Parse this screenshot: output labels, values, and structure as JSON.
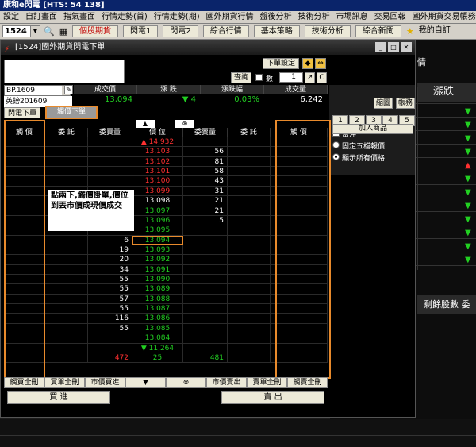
{
  "app": {
    "title": "康和e閃電 [HTS: 54 138]"
  },
  "menu": [
    "設定",
    "自訂畫面",
    "指氣畫面",
    "行情走勢(首)",
    "行情走勢(期)",
    "國外期貨行情",
    "盤後分析",
    "技術分析",
    "市場訊息",
    "交易回報",
    "國外期貨交易帳務",
    "智慧下單"
  ],
  "toolbar": {
    "symbol": "1524",
    "buttons": [
      "個股期貨",
      "閃電1",
      "閃電2",
      "綜合行情",
      "基本策略",
      "技術分析",
      "綜合新聞"
    ],
    "favorite": "我的自訂"
  },
  "window": {
    "title": "[1524]國外期貨閃電下單",
    "order_setting": "下單設定",
    "query": "查詢",
    "qty_label": "數",
    "qty_value": "1",
    "contract_code": "BP.1609",
    "contract_name": "英鎊201609",
    "quote_headers": [
      "成交價",
      "漲 跌",
      "漲跌幅",
      "成交量"
    ],
    "quote_values": {
      "price": "13,094",
      "change": "▼ 4",
      "pct": "0.03%",
      "volume": "6,242"
    },
    "tabs": [
      "閃電下單",
      "觸價下單"
    ],
    "right": {
      "btn_zoom": "縮圖",
      "btn_account": "帳務",
      "num_buttons": [
        "1",
        "2",
        "3",
        "4",
        "5"
      ],
      "opt_offset": "當沖",
      "opt_fixed": "固定五檔報價",
      "opt_all": "顯示所有價格",
      "add_item": "加入商品"
    },
    "ladder_head": {
      "up": "▲",
      "down": "⊗"
    },
    "columns": [
      "觸 價",
      "委 託",
      "委買量",
      "價 位",
      "委賣量",
      "委 託",
      "觸 價"
    ],
    "rows": [
      {
        "bid": "",
        "price": "▲ 14,932",
        "ask": "",
        "pc": "red"
      },
      {
        "bid": "",
        "price": "13,103",
        "ask": "56",
        "pc": "red"
      },
      {
        "bid": "",
        "price": "13,102",
        "ask": "81",
        "pc": "red"
      },
      {
        "bid": "",
        "price": "13,101",
        "ask": "58",
        "pc": "red"
      },
      {
        "bid": "",
        "price": "13,100",
        "ask": "43",
        "pc": "red"
      },
      {
        "bid": "",
        "price": "13,099",
        "ask": "31",
        "pc": "red"
      },
      {
        "bid": "",
        "price": "13,098",
        "ask": "21",
        "pc": "white"
      },
      {
        "bid": "",
        "price": "13,097",
        "ask": "21",
        "pc": "green"
      },
      {
        "bid": "",
        "price": "13,096",
        "ask": "5",
        "pc": "green"
      },
      {
        "bid": "",
        "price": "13,095",
        "ask": "",
        "pc": "green"
      },
      {
        "bid": "6",
        "price": "13,094",
        "ask": "",
        "pc": "green",
        "sel": true
      },
      {
        "bid": "19",
        "price": "13,093",
        "ask": "",
        "pc": "green"
      },
      {
        "bid": "20",
        "price": "13,092",
        "ask": "",
        "pc": "green"
      },
      {
        "bid": "34",
        "price": "13,091",
        "ask": "",
        "pc": "green"
      },
      {
        "bid": "55",
        "price": "13,090",
        "ask": "",
        "pc": "green"
      },
      {
        "bid": "55",
        "price": "13,089",
        "ask": "",
        "pc": "green"
      },
      {
        "bid": "57",
        "price": "13,088",
        "ask": "",
        "pc": "green"
      },
      {
        "bid": "55",
        "price": "13,087",
        "ask": "",
        "pc": "green"
      },
      {
        "bid": "116",
        "price": "13,086",
        "ask": "",
        "pc": "green"
      },
      {
        "bid": "55",
        "price": "13,085",
        "ask": "",
        "pc": "green"
      },
      {
        "bid": "",
        "price": "13,084",
        "ask": "",
        "pc": "green"
      },
      {
        "bid": "",
        "price": "▼ 11,264",
        "ask": "",
        "pc": "green"
      },
      {
        "bid": "472",
        "price": "25",
        "ask": "481",
        "pc": "green",
        "bidc": "red",
        "askc": "green"
      }
    ],
    "note": "點兩下,觸價掛單,價位到丟市價成現價成交",
    "bottom_buttons": [
      "觸買全刪",
      "買單全刪",
      "市價買進",
      "▼",
      "⊗",
      "市價賣出",
      "賣單全刪",
      "觸賣全刪"
    ],
    "buy": "買 進",
    "sell": "賣 出"
  },
  "background": {
    "header1": "漲跌",
    "header2": "剩餘股數",
    "header2b": "委",
    "tab_fragment": "情"
  }
}
